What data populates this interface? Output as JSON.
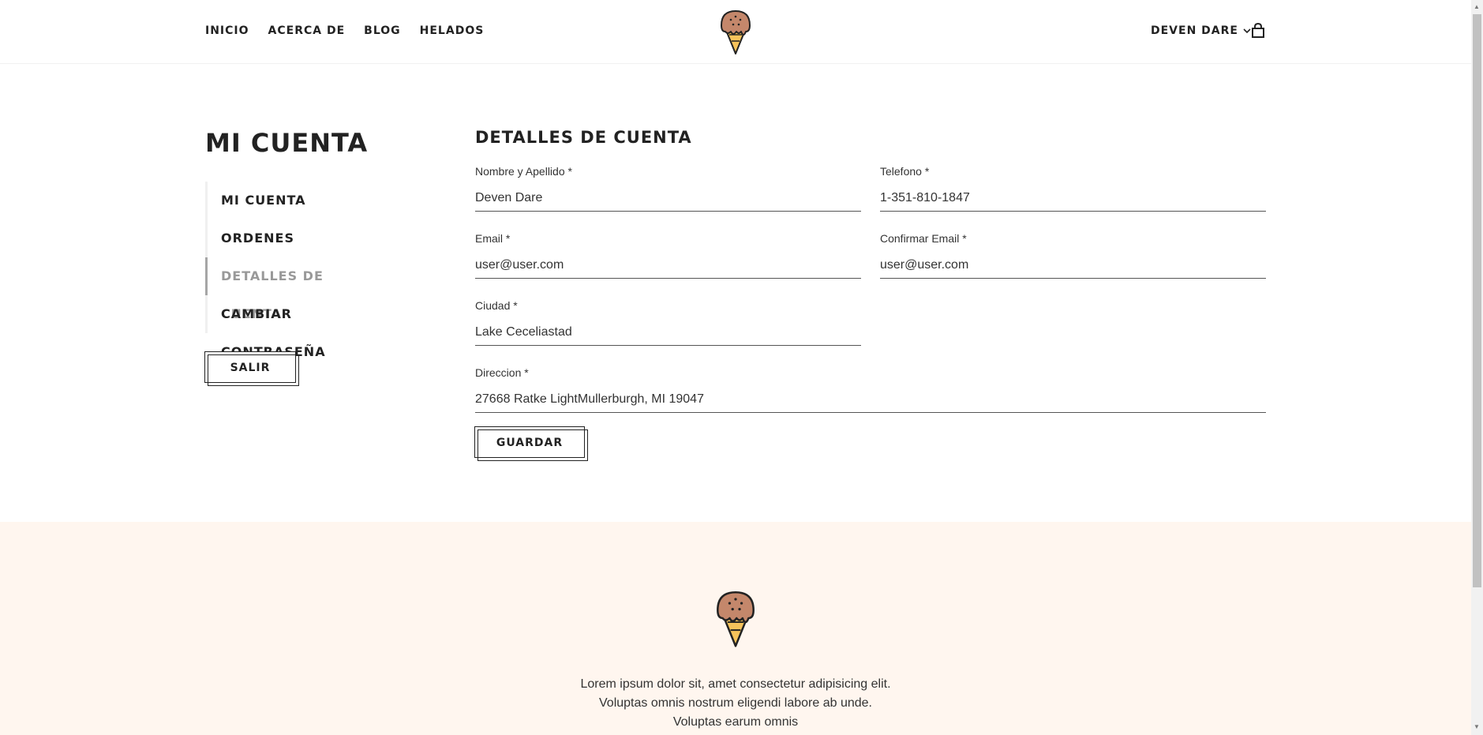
{
  "nav": {
    "items": [
      {
        "label": "INICIO"
      },
      {
        "label": "ACERCA DE"
      },
      {
        "label": "BLOG"
      },
      {
        "label": "HELADOS"
      }
    ],
    "user_label": "DEVEN DARE"
  },
  "icons": {
    "logo": "ice-cream-cone-icon",
    "chevron": "chevron-down-icon",
    "cart": "shopping-bag-icon"
  },
  "colors": {
    "ice_cream_scoop": "#c4876b",
    "cone": "#f6c35b",
    "footer_bg": "#fff6ef",
    "active_menu": "#999999"
  },
  "sidebar": {
    "title": "MI CUENTA",
    "items": [
      {
        "label": "MI CUENTA"
      },
      {
        "label": "ORDENES"
      },
      {
        "label": "DETALLES DE CUENTA",
        "active": true
      },
      {
        "label": "CAMBIAR CONTRASEÑA"
      }
    ],
    "logout_label": "SALIR"
  },
  "form": {
    "title": "DETALLES DE CUENTA",
    "fields": {
      "name": {
        "label": "Nombre y Apellido *",
        "value": "Deven Dare"
      },
      "phone": {
        "label": "Telefono *",
        "value": "1-351-810-1847"
      },
      "email": {
        "label": "Email *",
        "value": "user@user.com"
      },
      "confirm_email": {
        "label": "Confirmar Email *",
        "value": "user@user.com"
      },
      "city": {
        "label": "Ciudad *",
        "value": "Lake Ceceliastad"
      },
      "address": {
        "label": "Direccion *",
        "value": "27668 Ratke LightMullerburgh, MI 19047"
      }
    },
    "save_label": "GUARDAR"
  },
  "footer": {
    "text": "Lorem ipsum dolor sit, amet consectetur adipisicing elit. Voluptas omnis nostrum eligendi labore ab unde. Voluptas earum omnis"
  }
}
